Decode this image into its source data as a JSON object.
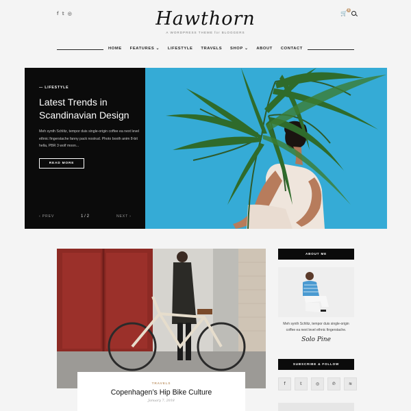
{
  "header": {
    "social": [
      "f",
      "𝕥",
      "◎"
    ],
    "cart_icon": "🛒",
    "cart_count": "0",
    "logo": "Hawthorn",
    "tagline": "A WORDPRESS THEME for BLOGGERS"
  },
  "nav": [
    {
      "label": "HOME"
    },
    {
      "label": "FEATURES ⌄"
    },
    {
      "label": "LIFESTYLE"
    },
    {
      "label": "TRAVELS"
    },
    {
      "label": "SHOP ⌄"
    },
    {
      "label": "ABOUT"
    },
    {
      "label": "CONTACT"
    }
  ],
  "hero": {
    "category": "— LIFESTYLE",
    "title": "Latest Trends in Scandinavian Design",
    "excerpt": "Meh synth Schlitz, tempor duis single-origin coffee ea next level ethnic fingerstache fanny pack nostrud. Photo booth anim 8-bit hella, PBR 3 wolf moon...",
    "button": "READ MORE",
    "prev": "‹ PREV",
    "counter": "1 / 2",
    "next": "NEXT ›",
    "bg_color": "#2fa6d3"
  },
  "post": {
    "category": "TRAVELS",
    "title": "Copenhagen’s Hip Bike Culture",
    "date": "January 7, 2018"
  },
  "sidebar": {
    "about_title": "ABOUT ME",
    "about_text": "Meh synth Schlitz, tempor duis single-origin coffee ea next level ethnic fingerstache.",
    "signature": "Solo Pine",
    "follow_title": "SUBSCRIBE & FOLLOW",
    "follow_icons": [
      "f",
      "𝕥",
      "◎",
      "℗",
      "≋"
    ]
  }
}
